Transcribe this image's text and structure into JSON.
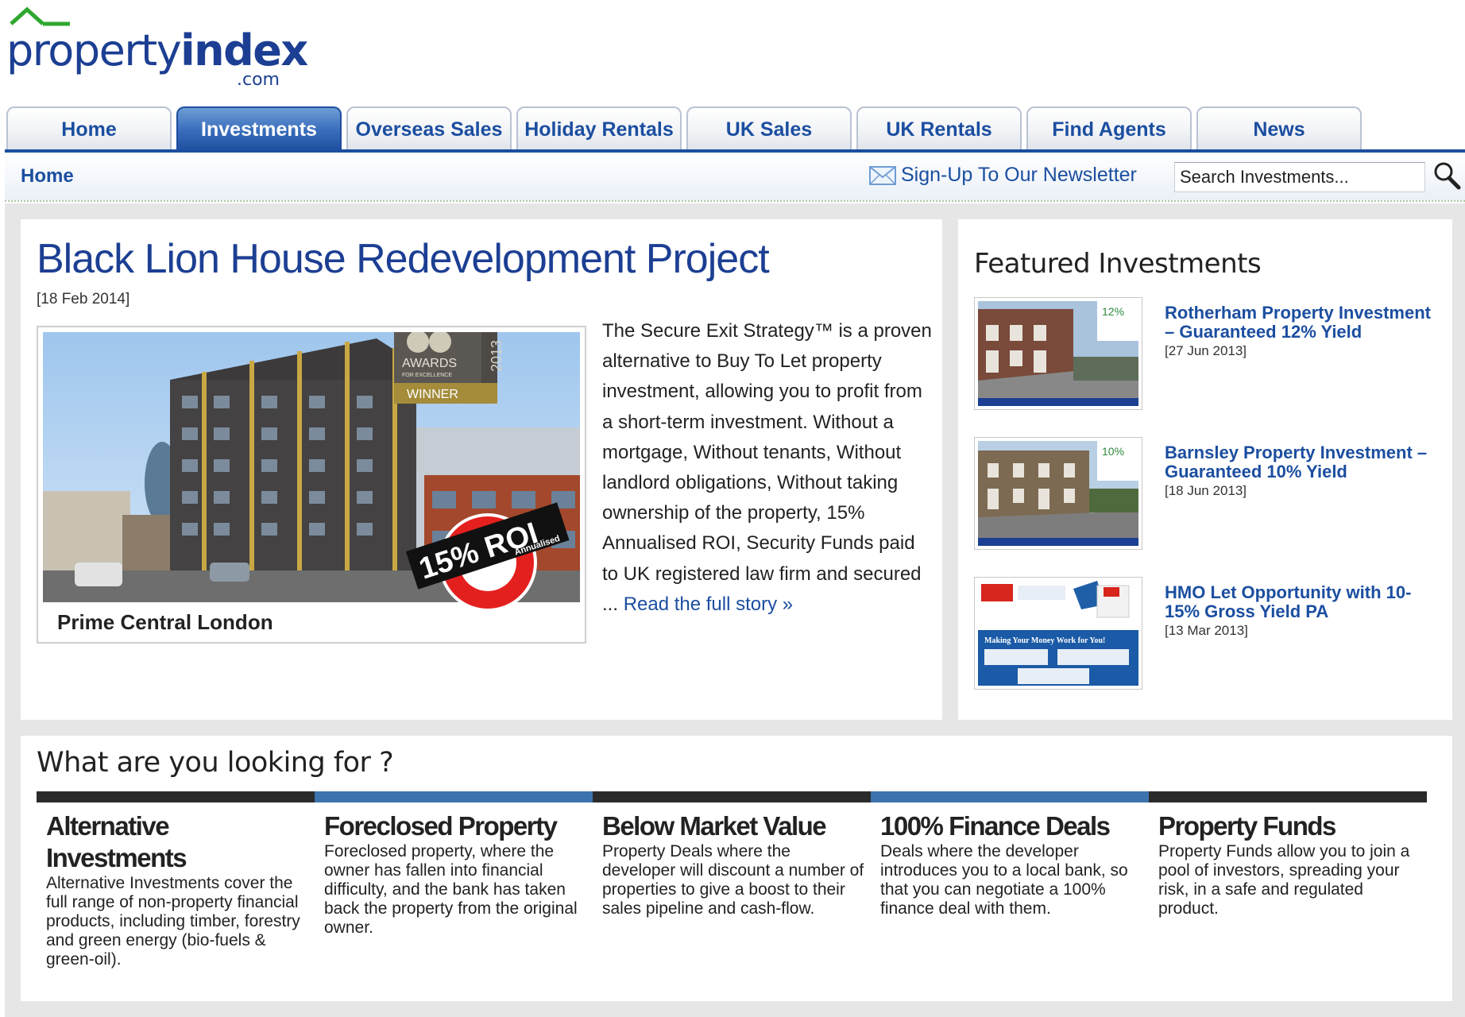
{
  "logo": {
    "part1": "property",
    "part2": "index",
    "suffix": ".com"
  },
  "nav": {
    "tabs": [
      {
        "label": "Home",
        "active": false
      },
      {
        "label": "Investments",
        "active": true
      },
      {
        "label": "Overseas Sales",
        "active": false
      },
      {
        "label": "Holiday Rentals",
        "active": false
      },
      {
        "label": "UK Sales",
        "active": false
      },
      {
        "label": "UK Rentals",
        "active": false
      },
      {
        "label": "Find Agents",
        "active": false
      },
      {
        "label": "News",
        "active": false
      }
    ]
  },
  "subbar": {
    "breadcrumb": "Home",
    "newsletter": "Sign-Up To Our Newsletter",
    "search_value": "Search Investments..."
  },
  "article": {
    "title": "Black Lion House Redevelopment Project",
    "date": "[18 Feb 2014]",
    "body": "The Secure Exit Strategy™ is a proven alternative to Buy To Let property investment, allowing you to profit from a short-term investment. Without a mortgage, Without tenants, Without landlord obligations, Without taking ownership of the property, 15% Annualised ROI, Security Funds paid to UK registered law firm and secured ...",
    "read_more": "Read the full story »",
    "image": {
      "award_year": "2013",
      "award_line1": "AWARDS",
      "award_line2": "FOR EXCELLENCE",
      "award_line3": "WINNER",
      "roi_big": "15% ROI",
      "roi_small": "Annualised",
      "caption": "Prime Central London"
    }
  },
  "featured": {
    "title": "Featured Investments",
    "items": [
      {
        "title": "Rotherham Property Investment – Guaranteed 12% Yield",
        "date": "[27 Jun 2013]",
        "badge": "12%"
      },
      {
        "title": "Barnsley Property Investment – Guaranteed 10% Yield",
        "date": "[18 Jun 2013]",
        "badge": "10%"
      },
      {
        "title": "HMO Let Opportunity with 10-15% Gross Yield PA",
        "date": "[13 Mar 2013]",
        "badge": "Making Your Money Work for You!"
      }
    ]
  },
  "looking": {
    "title": "What are you looking for ?",
    "categories": [
      {
        "heading": "Alternative Investments",
        "desc": "Alternative Investments cover the full range of non-property financial products, including timber, forestry and green energy (bio-fuels & green-oil).",
        "bar": "#2b2b2b"
      },
      {
        "heading": "Foreclosed Property",
        "desc": "Foreclosed property, where the owner has fallen into financial difficulty, and the bank has taken back the property from the original owner.",
        "bar": "#3c73ad"
      },
      {
        "heading": "Below Market Value",
        "desc": "Property Deals where the developer will discount a number of properties to give a boost to their sales pipeline and cash-flow.",
        "bar": "#2b2b2b"
      },
      {
        "heading": "100% Finance Deals",
        "desc": "Deals where the developer introduces you to a local bank, so that you can negotiate a 100% finance deal with them.",
        "bar": "#3c73ad"
      },
      {
        "heading": "Property Funds",
        "desc": "Property Funds allow you to join a pool of investors, spreading your risk, in a safe and regulated product.",
        "bar": "#2b2b2b"
      }
    ]
  }
}
